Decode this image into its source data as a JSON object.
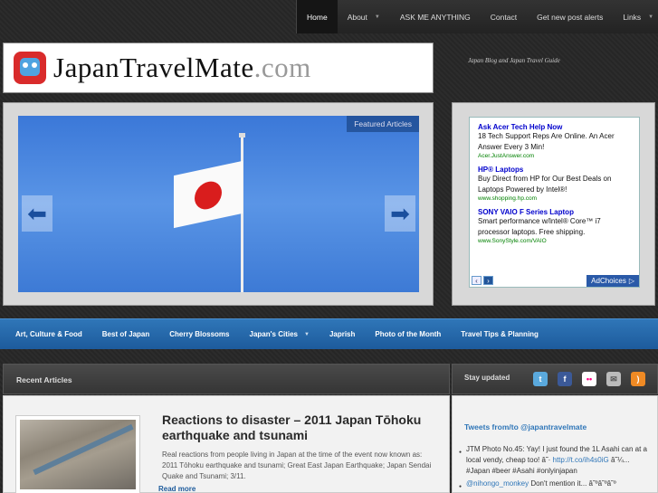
{
  "topnav": {
    "items": [
      {
        "label": "Home",
        "active": true,
        "dropdown": false
      },
      {
        "label": "About",
        "active": false,
        "dropdown": true
      },
      {
        "label": "ASK ME ANYTHING",
        "active": false,
        "dropdown": false
      },
      {
        "label": "Contact",
        "active": false,
        "dropdown": false
      },
      {
        "label": "Get new post alerts",
        "active": false,
        "dropdown": false
      },
      {
        "label": "Links",
        "active": false,
        "dropdown": true
      }
    ]
  },
  "logo": {
    "main": "JapanTravelMate",
    "domain": ".com"
  },
  "tagline": "Japan Blog and Japan Travel Guide",
  "slider": {
    "label": "Featured Articles",
    "prev_icon": "arrow-left-icon",
    "next_icon": "arrow-right-icon"
  },
  "ads": {
    "items": [
      {
        "title": "Ask Acer Tech Help Now",
        "desc": "18 Tech Support Reps Are Online. An Acer Answer Every 3 Min!",
        "url": "Acer.JustAnswer.com"
      },
      {
        "title": "HP® Laptops",
        "desc": "Buy Direct from HP for Our Best Deals on Laptops Powered by Intel®!",
        "url": "www.shopping.hp.com"
      },
      {
        "title": "SONY VAIO F Series Laptop",
        "desc": "Smart performance w/Intel® Core™ i7 processor laptops. Free shipping.",
        "url": "www.SonyStyle.com/VAIO"
      }
    ],
    "prev": "‹",
    "next": "›",
    "adchoices": "AdChoices"
  },
  "catnav": {
    "items": [
      {
        "label": "Art, Culture & Food",
        "dropdown": false
      },
      {
        "label": "Best of Japan",
        "dropdown": false
      },
      {
        "label": "Cherry Blossoms",
        "dropdown": false
      },
      {
        "label": "Japan's Cities",
        "dropdown": true
      },
      {
        "label": "Japrish",
        "dropdown": false
      },
      {
        "label": "Photo of the Month",
        "dropdown": false
      },
      {
        "label": "Travel Tips & Planning",
        "dropdown": false
      }
    ]
  },
  "recent": {
    "heading": "Recent Articles",
    "article": {
      "title": "Reactions to disaster – 2011 Japan Tōhoku earthquake and tsunami",
      "text": "Real reactions from people living in Japan at the time of the event now known as: 2011 Tōhoku earthquake and tsunami; Great East Japan Earthquake; Japan Sendai Quake and Tsunami; 3/11.",
      "read_more": "Read more"
    }
  },
  "stay": {
    "heading": "Stay updated",
    "social": [
      {
        "name": "twitter-icon",
        "glyph": "t"
      },
      {
        "name": "facebook-icon",
        "glyph": "f"
      },
      {
        "name": "flickr-icon",
        "glyph": "••"
      },
      {
        "name": "email-icon",
        "glyph": "✉"
      },
      {
        "name": "rss-icon",
        "glyph": ")"
      }
    ]
  },
  "twitter": {
    "title": "Tweets from/to @japantravelmate",
    "tweets": [
      {
        "text": "JTM Photo No.45: Yay! I just found the 1L Asahi can at a local vendy, cheap too! â˜· ",
        "link": "http://t.co/ih4s0iG",
        "tail": " â˜¼... #Japan #beer #Asahi #onlyinjapan"
      },
      {
        "text": "",
        "link": "@nihongo_monkey",
        "tail": " Don't mention it... â˜ºâ˜ºâ˜º"
      }
    ]
  }
}
